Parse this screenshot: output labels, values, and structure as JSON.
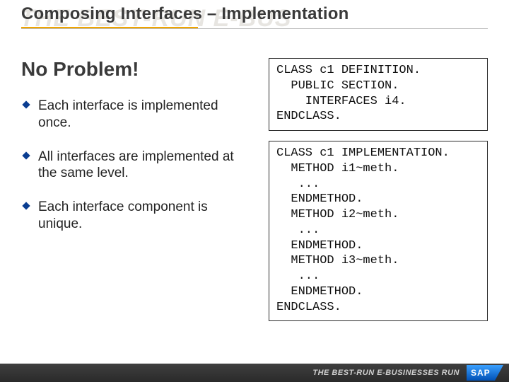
{
  "banner_text": "THE BEST-RUN E-BUS",
  "title": "Composing Interfaces – Implementation",
  "headline": "No Problem!",
  "bullets": [
    "Each interface is implemented once.",
    "All interfaces are implemented at the same level.",
    "Each interface component is unique."
  ],
  "code_blocks": [
    "CLASS c1 DEFINITION.\n  PUBLIC SECTION.\n    INTERFACES i4.\nENDCLASS.",
    "CLASS c1 IMPLEMENTATION.\n  METHOD i1~meth.\n   ...\n  ENDMETHOD.\n  METHOD i2~meth.\n   ...\n  ENDMETHOD.\n  METHOD i3~meth.\n   ...\n  ENDMETHOD.\nENDCLASS."
  ],
  "footer_text": "THE BEST-RUN E-BUSINESSES RUN",
  "logo_label": "SAP",
  "colors": {
    "accent": "#f0a500",
    "bullet": "#0a3d91",
    "code_border": "#2a2a2a"
  }
}
